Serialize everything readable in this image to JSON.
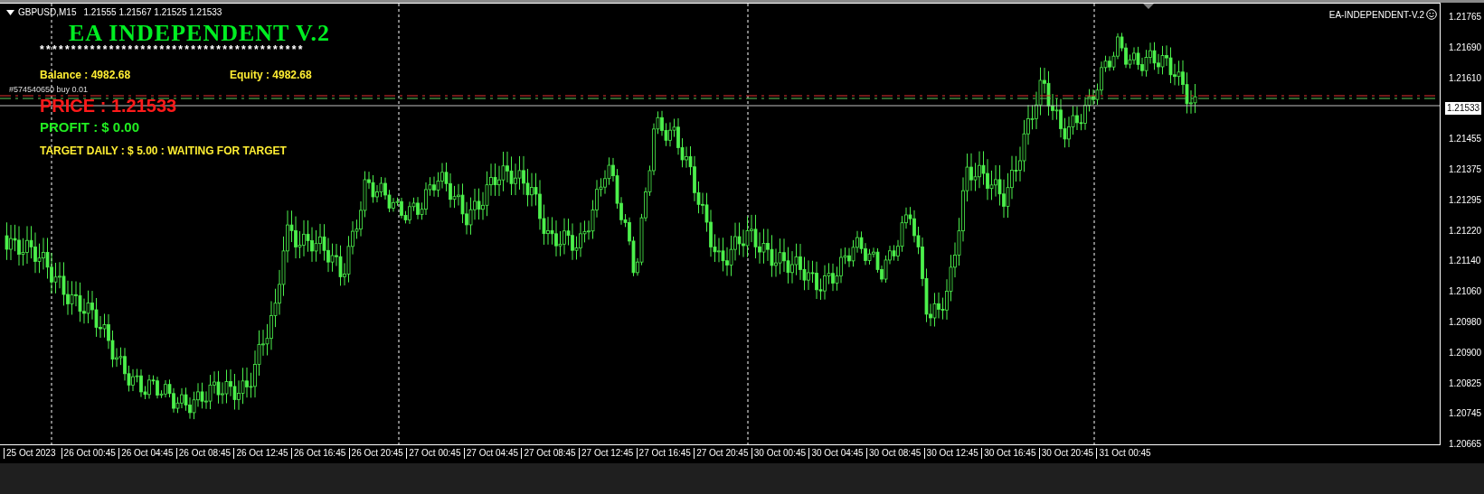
{
  "chart_header": {
    "symbol": "GBPUSD,M15",
    "quotes": "1.21555 1.21567 1.21525 1.21533"
  },
  "expert": {
    "name": "EA-INDEPENDENT-V.2"
  },
  "panel": {
    "title": "EA INDEPENDENT V.2",
    "separator": "******************************************",
    "balance": "Balance : 4982.68",
    "equity": "Equity : 4982.68",
    "price": "PRICE : 1.21533",
    "profit": "PROFIT  : $ 0.00",
    "target": "TARGET DAILY : $ 5.00 : WAITING FOR TARGET"
  },
  "order_label": "#574540650 buy 0.01",
  "price_axis": [
    {
      "label": "1.21765",
      "kind": "tick"
    },
    {
      "label": "1.21690",
      "kind": "tick"
    },
    {
      "label": "1.21610",
      "kind": "tick"
    },
    {
      "label": "1.21533",
      "kind": "current"
    },
    {
      "label": "1.21455",
      "kind": "tick"
    },
    {
      "label": "1.21375",
      "kind": "tick"
    },
    {
      "label": "1.21295",
      "kind": "tick"
    },
    {
      "label": "1.21220",
      "kind": "tick"
    },
    {
      "label": "1.21140",
      "kind": "tick"
    },
    {
      "label": "1.21060",
      "kind": "tick"
    },
    {
      "label": "1.20980",
      "kind": "tick"
    },
    {
      "label": "1.20900",
      "kind": "tick"
    },
    {
      "label": "1.20825",
      "kind": "tick"
    },
    {
      "label": "1.20745",
      "kind": "tick"
    },
    {
      "label": "1.20665",
      "kind": "tick"
    }
  ],
  "time_axis": [
    "25 Oct 2023",
    "26 Oct 00:45",
    "26 Oct 04:45",
    "26 Oct 08:45",
    "26 Oct 12:45",
    "26 Oct 16:45",
    "26 Oct 20:45",
    "27 Oct 00:45",
    "27 Oct 04:45",
    "27 Oct 08:45",
    "27 Oct 12:45",
    "27 Oct 16:45",
    "27 Oct 20:45",
    "30 Oct 00:45",
    "30 Oct 04:45",
    "30 Oct 08:45",
    "30 Oct 12:45",
    "30 Oct 16:45",
    "30 Oct 20:45",
    "31 Oct 00:45"
  ]
}
